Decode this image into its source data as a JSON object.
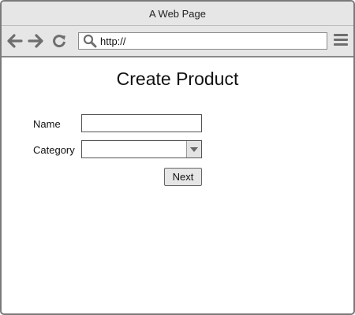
{
  "window": {
    "title": "A Web Page"
  },
  "toolbar": {
    "back_icon": "arrow-left-icon",
    "forward_icon": "arrow-right-icon",
    "reload_icon": "reload-icon",
    "search_icon": "search-icon",
    "menu_icon": "hamburger-menu-icon",
    "address_value": "http://"
  },
  "page": {
    "title": "Create Product",
    "form": {
      "name_label": "Name",
      "name_value": "",
      "category_label": "Category",
      "category_value": "",
      "next_label": "Next"
    }
  },
  "colors": {
    "chrome_background": "#e6e6e6",
    "border": "#7a7a7a",
    "icon": "#6e6e6e"
  }
}
